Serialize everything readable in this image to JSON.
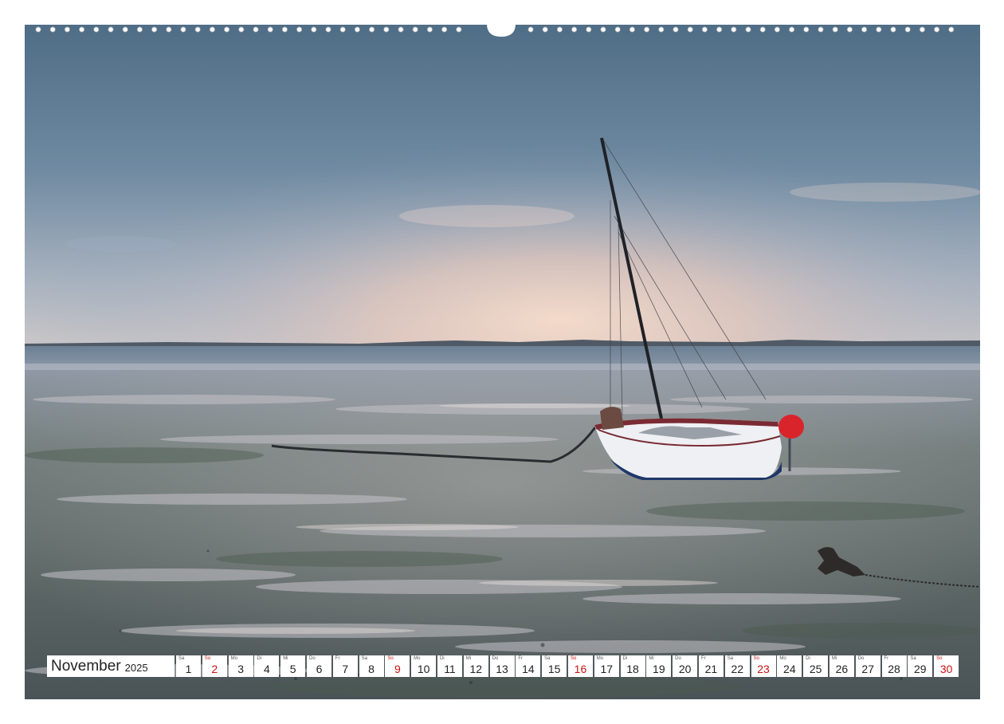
{
  "calendar": {
    "month": "November",
    "year": "2025",
    "days": [
      {
        "weekday": "Sa",
        "day": "1",
        "sunday": false
      },
      {
        "weekday": "So",
        "day": "2",
        "sunday": true
      },
      {
        "weekday": "Mo",
        "day": "3",
        "sunday": false
      },
      {
        "weekday": "Di",
        "day": "4",
        "sunday": false
      },
      {
        "weekday": "Mi",
        "day": "5",
        "sunday": false
      },
      {
        "weekday": "Do",
        "day": "6",
        "sunday": false
      },
      {
        "weekday": "Fr",
        "day": "7",
        "sunday": false
      },
      {
        "weekday": "Sa",
        "day": "8",
        "sunday": false
      },
      {
        "weekday": "So",
        "day": "9",
        "sunday": true
      },
      {
        "weekday": "Mo",
        "day": "10",
        "sunday": false
      },
      {
        "weekday": "Di",
        "day": "11",
        "sunday": false
      },
      {
        "weekday": "Mi",
        "day": "12",
        "sunday": false
      },
      {
        "weekday": "Do",
        "day": "13",
        "sunday": false
      },
      {
        "weekday": "Fr",
        "day": "14",
        "sunday": false
      },
      {
        "weekday": "Sa",
        "day": "15",
        "sunday": false
      },
      {
        "weekday": "So",
        "day": "16",
        "sunday": true
      },
      {
        "weekday": "Mo",
        "day": "17",
        "sunday": false
      },
      {
        "weekday": "Di",
        "day": "18",
        "sunday": false
      },
      {
        "weekday": "Mi",
        "day": "19",
        "sunday": false
      },
      {
        "weekday": "Do",
        "day": "20",
        "sunday": false
      },
      {
        "weekday": "Fr",
        "day": "21",
        "sunday": false
      },
      {
        "weekday": "Sa",
        "day": "22",
        "sunday": false
      },
      {
        "weekday": "So",
        "day": "23",
        "sunday": true
      },
      {
        "weekday": "Mo",
        "day": "24",
        "sunday": false
      },
      {
        "weekday": "Di",
        "day": "25",
        "sunday": false
      },
      {
        "weekday": "Mi",
        "day": "26",
        "sunday": false
      },
      {
        "weekday": "Do",
        "day": "27",
        "sunday": false
      },
      {
        "weekday": "Fr",
        "day": "28",
        "sunday": false
      },
      {
        "weekday": "Sa",
        "day": "29",
        "sunday": false
      },
      {
        "weekday": "So",
        "day": "30",
        "sunday": true
      }
    ]
  },
  "colors": {
    "sunday": "#cc1111",
    "text": "#222222",
    "cell_background": "#ffffff"
  }
}
